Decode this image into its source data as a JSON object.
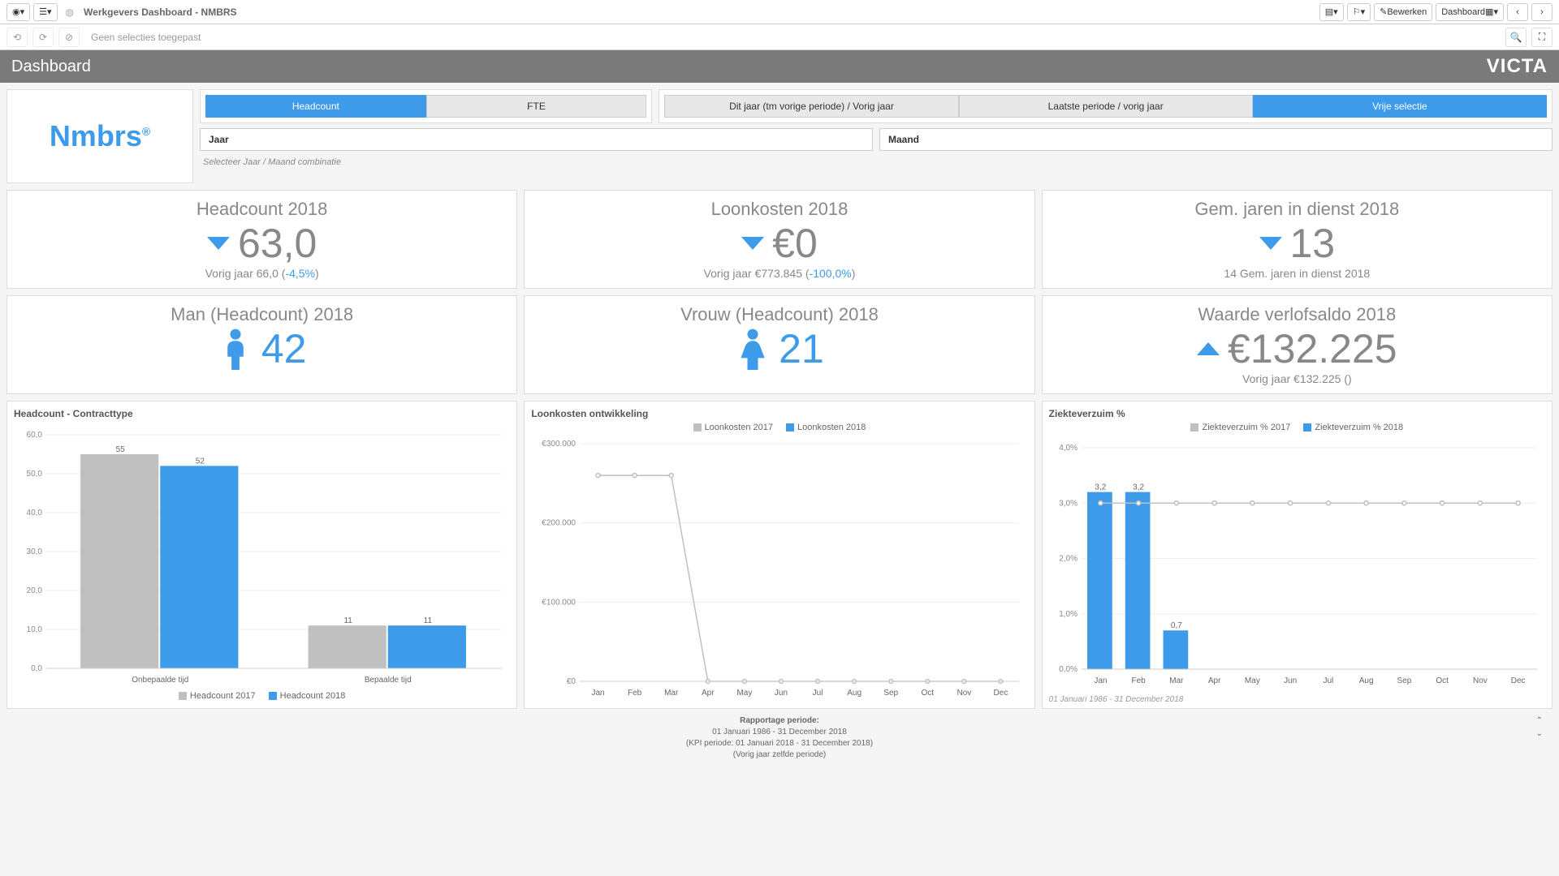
{
  "topbar": {
    "title": "Werkgevers Dashboard - NMBRS",
    "edit_label": "Bewerken",
    "dashboard_label": "Dashboard"
  },
  "selbar": {
    "no_selections": "Geen selecties toegepast"
  },
  "header": {
    "title": "Dashboard",
    "brand": "VICTA"
  },
  "logo": "Nmbrs",
  "tabs1": [
    "Headcount",
    "FTE"
  ],
  "tabs1_active": 0,
  "tabs2": [
    "Dit jaar (tm vorige periode) / Vorig jaar",
    "Laatste periode / vorig jaar",
    "Vrije selectie"
  ],
  "tabs2_active": 2,
  "filters": {
    "jaar": "Jaar",
    "maand": "Maand"
  },
  "helper": "Selecteer Jaar / Maand combinatie",
  "kpi": [
    {
      "title": "Headcount 2018",
      "value": "63,0",
      "trend": "down",
      "sub": "Vorig jaar 66,0 (",
      "delta": "-4,5%",
      "sub2": ")"
    },
    {
      "title": "Loonkosten 2018",
      "value": "€0",
      "trend": "down",
      "sub": "Vorig jaar €773.845 (",
      "delta": "-100,0%",
      "sub2": ")"
    },
    {
      "title": "Gem. jaren in dienst 2018",
      "value": "13",
      "trend": "down",
      "sub": "14 Gem. jaren in dienst 2018",
      "delta": "",
      "sub2": ""
    }
  ],
  "kpi2": [
    {
      "title": "Man (Headcount) 2018",
      "value": "42",
      "icon": "male"
    },
    {
      "title": "Vrouw (Headcount) 2018",
      "value": "21",
      "icon": "female"
    },
    {
      "title": "Waarde verlofsaldo 2018",
      "value": "€132.225",
      "trend": "up",
      "sub": "Vorig jaar €132.225 ()"
    }
  ],
  "charts": {
    "contract": {
      "title": "Headcount - Contracttype",
      "legend": [
        "Headcount 2017",
        "Headcount 2018"
      ]
    },
    "loon": {
      "title": "Loonkosten ontwikkeling",
      "legend": [
        "Loonkosten 2017",
        "Loonkosten 2018"
      ]
    },
    "ziekte": {
      "title": "Ziekteverzuim %",
      "legend": [
        "Ziekteverzuim % 2017",
        "Ziekteverzuim % 2018"
      ],
      "footnote": "01 Januari 1986 - 31 December 2018"
    }
  },
  "footer": {
    "l1": "Rapportage periode:",
    "l2": "01 Januari 1986 - 31 December 2018",
    "l3": "(KPI periode: 01 Januari 2018 - 31 December 2018)",
    "l4": "(Vorig jaar zelfde periode)"
  },
  "chart_data": [
    {
      "type": "bar",
      "title": "Headcount - Contracttype",
      "categories": [
        "Onbepaalde tijd",
        "Bepaalde tijd"
      ],
      "series": [
        {
          "name": "Headcount 2017",
          "values": [
            55.0,
            11.0
          ],
          "color": "#c0c0c0"
        },
        {
          "name": "Headcount 2018",
          "values": [
            52.0,
            11.0
          ],
          "color": "#3d9be9"
        }
      ],
      "ylabel": "",
      "ylim": [
        0,
        60
      ],
      "yticks": [
        0,
        10,
        20,
        30,
        40,
        50,
        60
      ]
    },
    {
      "type": "line",
      "title": "Loonkosten ontwikkeling",
      "x": [
        "Jan",
        "Feb",
        "Mar",
        "Apr",
        "May",
        "Jun",
        "Jul",
        "Aug",
        "Sep",
        "Oct",
        "Nov",
        "Dec"
      ],
      "series": [
        {
          "name": "Loonkosten 2017",
          "values": [
            260000,
            260000,
            260000,
            0,
            0,
            0,
            0,
            0,
            0,
            0,
            0,
            0
          ],
          "color": "#c0c0c0"
        },
        {
          "name": "Loonkosten 2018",
          "values": [],
          "color": "#3d9be9"
        }
      ],
      "ylabel": "",
      "ylim": [
        0,
        300000
      ],
      "yticks": [
        0,
        100000,
        200000,
        300000
      ],
      "ytick_labels": [
        "€0",
        "€100.000",
        "€200.000",
        "€300.000"
      ]
    },
    {
      "type": "bar",
      "title": "Ziekteverzuim %",
      "categories": [
        "Jan",
        "Feb",
        "Mar",
        "Apr",
        "May",
        "Jun",
        "Jul",
        "Aug",
        "Sep",
        "Oct",
        "Nov",
        "Dec"
      ],
      "series": [
        {
          "name": "Ziekteverzuim % 2017",
          "values": [
            3.0,
            3.0,
            3.0,
            3.0,
            3.0,
            3.0,
            3.0,
            3.0,
            3.0,
            3.0,
            3.0,
            3.0
          ],
          "color": "#c0c0c0",
          "render": "line"
        },
        {
          "name": "Ziekteverzuim % 2018",
          "values": [
            3.2,
            3.2,
            0.7,
            0,
            0,
            0,
            0,
            0,
            0,
            0,
            0,
            0
          ],
          "color": "#3d9be9",
          "render": "bar"
        }
      ],
      "ylabel": "",
      "ylim": [
        0,
        4
      ],
      "yticks": [
        0,
        1,
        2,
        3,
        4
      ],
      "ytick_labels": [
        "0,0%",
        "1,0%",
        "2,0%",
        "3,0%",
        "4,0%"
      ]
    }
  ]
}
